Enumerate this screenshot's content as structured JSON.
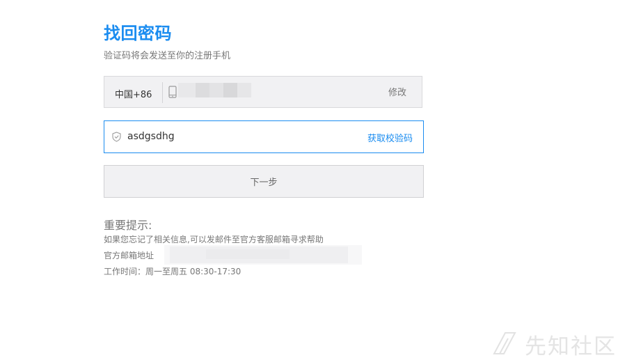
{
  "page": {
    "title": "找回密码",
    "subtitle": "验证码将会发送至你的注册手机"
  },
  "phone": {
    "country_code": "中国+86",
    "edit_label": "修改"
  },
  "verification": {
    "code_value": "asdgsdhg",
    "get_code_label": "获取校验码"
  },
  "next_button": {
    "label": "下一步"
  },
  "tips": {
    "title": "重要提示:",
    "line1": "如果您忘记了相关信息,可以发邮件至官方客服邮箱寻求帮助",
    "line2": "官方邮箱地址",
    "line3": "工作时间：周一至周五 08:30-17:30"
  },
  "watermark": {
    "text": "先知社区"
  },
  "colors": {
    "accent": "#1a8cf0",
    "muted_text": "#777777",
    "box_bg": "#f1f1f3"
  }
}
